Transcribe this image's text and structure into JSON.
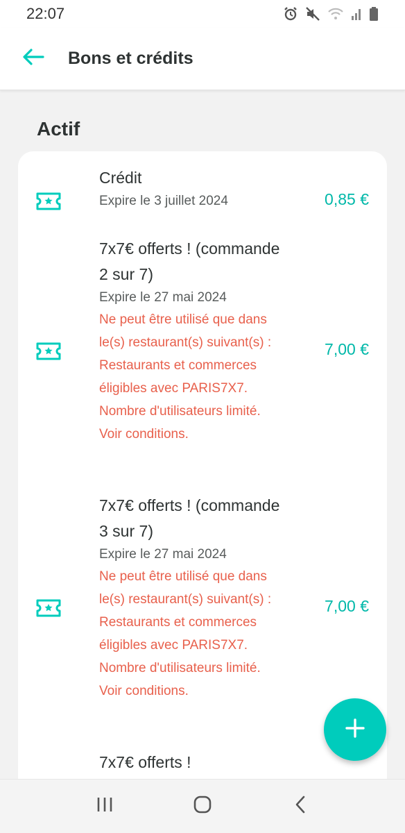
{
  "status": {
    "time": "22:07",
    "icons": [
      "alarm-icon",
      "mute-icon",
      "wifi-icon",
      "signal-icon",
      "battery-icon"
    ]
  },
  "header": {
    "title": "Bons et crédits",
    "back_icon": "arrow-left-icon"
  },
  "section": {
    "title": "Actif"
  },
  "items": [
    {
      "name": "Crédit",
      "expiry": "Expire le 3 juillet 2024",
      "conditions": "",
      "amount": "0,85 €"
    },
    {
      "name": "7x7€ offerts ! (commande 2 sur 7)",
      "expiry": "Expire le 27 mai 2024",
      "conditions": "Ne peut être utilisé que dans le(s) restaurant(s) suivant(s) : Restaurants et commerces éligibles avec PARIS7X7. Nombre d'utilisateurs limité. Voir conditions.",
      "amount": "7,00 €"
    },
    {
      "name": "7x7€ offerts ! (commande 3 sur 7)",
      "expiry": "Expire le 27 mai 2024",
      "conditions": "Ne peut être utilisé que dans le(s) restaurant(s) suivant(s) : Restaurants et commerces éligibles avec PARIS7X7. Nombre d'utilisateurs limité. Voir conditions.",
      "amount": "7,00 €"
    },
    {
      "name": "7x7€ offerts !",
      "expiry": "",
      "conditions": "",
      "amount": ""
    }
  ],
  "fab": {
    "icon": "plus-icon"
  },
  "navigation": {
    "icons": [
      "recent-apps-icon",
      "home-icon",
      "back-icon"
    ]
  },
  "colors": {
    "accent": "#00ccbc",
    "amount_text": "#00b8a9",
    "condition_text": "#e8604c"
  }
}
